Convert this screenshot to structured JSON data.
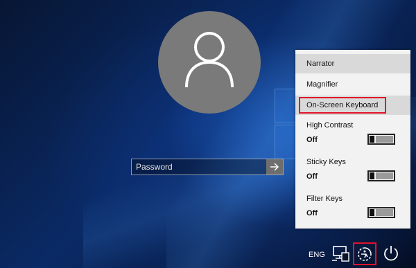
{
  "password": {
    "placeholder": "Password",
    "value": ""
  },
  "ease_of_access_menu": {
    "narrator": "Narrator",
    "magnifier": "Magnifier",
    "on_screen_keyboard": "On-Screen Keyboard",
    "toggles": [
      {
        "label": "High Contrast",
        "state": "Off"
      },
      {
        "label": "Sticky Keys",
        "state": "Off"
      },
      {
        "label": "Filter Keys",
        "state": "Off"
      }
    ]
  },
  "taskbar": {
    "language": "ENG",
    "icons": [
      "network-icon",
      "ease-of-access-icon",
      "power-icon"
    ]
  },
  "colors": {
    "highlight_box": "#e0142a",
    "menu_background": "#f2f2f2",
    "avatar_background": "#7a7a7a"
  }
}
